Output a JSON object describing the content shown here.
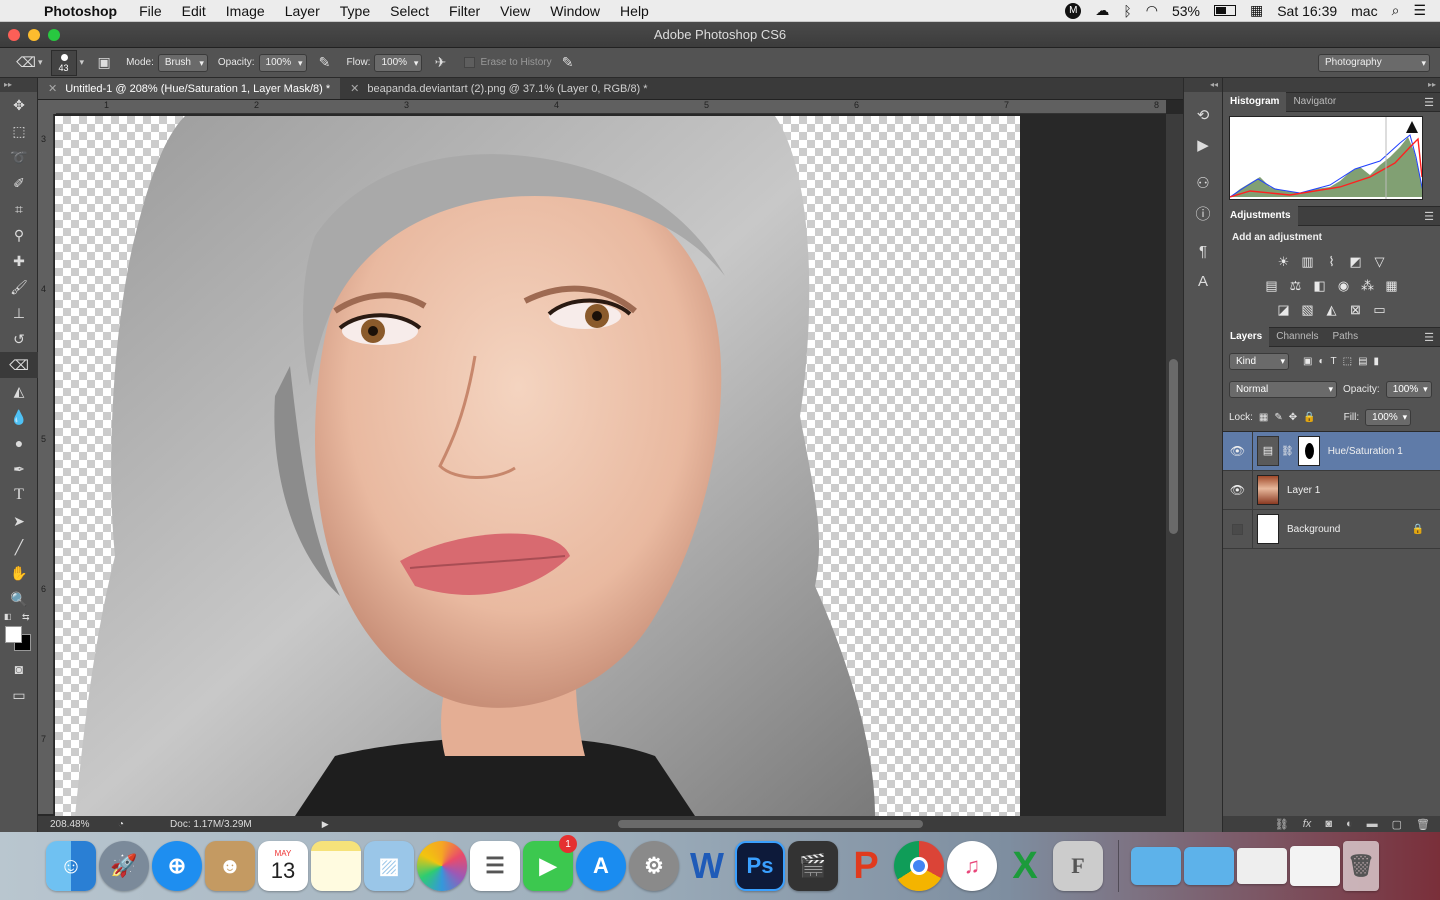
{
  "menubar": {
    "app": "Photoshop",
    "items": [
      "File",
      "Edit",
      "Image",
      "Layer",
      "Type",
      "Select",
      "Filter",
      "View",
      "Window",
      "Help"
    ],
    "battery": "53%",
    "clock": "Sat 16:39",
    "user": "mac"
  },
  "window": {
    "title": "Adobe Photoshop CS6"
  },
  "options": {
    "brush_size": "43",
    "mode_label": "Mode:",
    "mode_value": "Brush",
    "opacity_label": "Opacity:",
    "opacity_value": "100%",
    "flow_label": "Flow:",
    "flow_value": "100%",
    "erase_history": "Erase to History",
    "workspace": "Photography"
  },
  "tabs": [
    {
      "label": "Untitled-1 @ 208% (Hue/Saturation 1, Layer Mask/8) *"
    },
    {
      "label": "beapanda.deviantart (2).png @ 37.1% (Layer 0, RGB/8) *"
    }
  ],
  "ruler": {
    "h": [
      "1",
      "2",
      "3",
      "4",
      "5",
      "6",
      "7",
      "8"
    ],
    "v": [
      "3",
      "4",
      "5",
      "6",
      "7"
    ]
  },
  "status": {
    "zoom": "208.48%",
    "doc": "Doc: 1.17M/3.29M"
  },
  "panels": {
    "histogram_tabs": [
      "Histogram",
      "Navigator"
    ],
    "adjustments_tab": "Adjustments",
    "add_adjustment": "Add an adjustment",
    "layer_tabs": [
      "Layers",
      "Channels",
      "Paths"
    ],
    "kind": "Kind",
    "blend_mode": "Normal",
    "opacity_label": "Opacity:",
    "opacity_value": "100%",
    "lock_label": "Lock:",
    "fill_label": "Fill:",
    "fill_value": "100%",
    "layers": [
      {
        "name": "Hue/Saturation 1",
        "visible": true,
        "selected": true
      },
      {
        "name": "Layer 1",
        "visible": true,
        "selected": false
      },
      {
        "name": "Background",
        "visible": false,
        "selected": false
      }
    ]
  },
  "dock": {
    "calendar_month": "MAY",
    "calendar_day": "13",
    "facetime_badge": "1",
    "apps": [
      "Finder",
      "Launchpad",
      "Safari",
      "Contacts",
      "Calendar",
      "Notes",
      "Preview",
      "Photos",
      "Reminders",
      "FaceTime",
      "App Store",
      "System Preferences",
      "Word",
      "Photoshop",
      "Final Cut Pro",
      "PowerPoint",
      "Chrome",
      "iTunes",
      "Excel",
      "Font Book",
      "Downloads",
      "Documents",
      "Trash"
    ]
  },
  "colors": {
    "accent_selected_layer": "#5f7ba8",
    "panel_bg": "#535353"
  }
}
